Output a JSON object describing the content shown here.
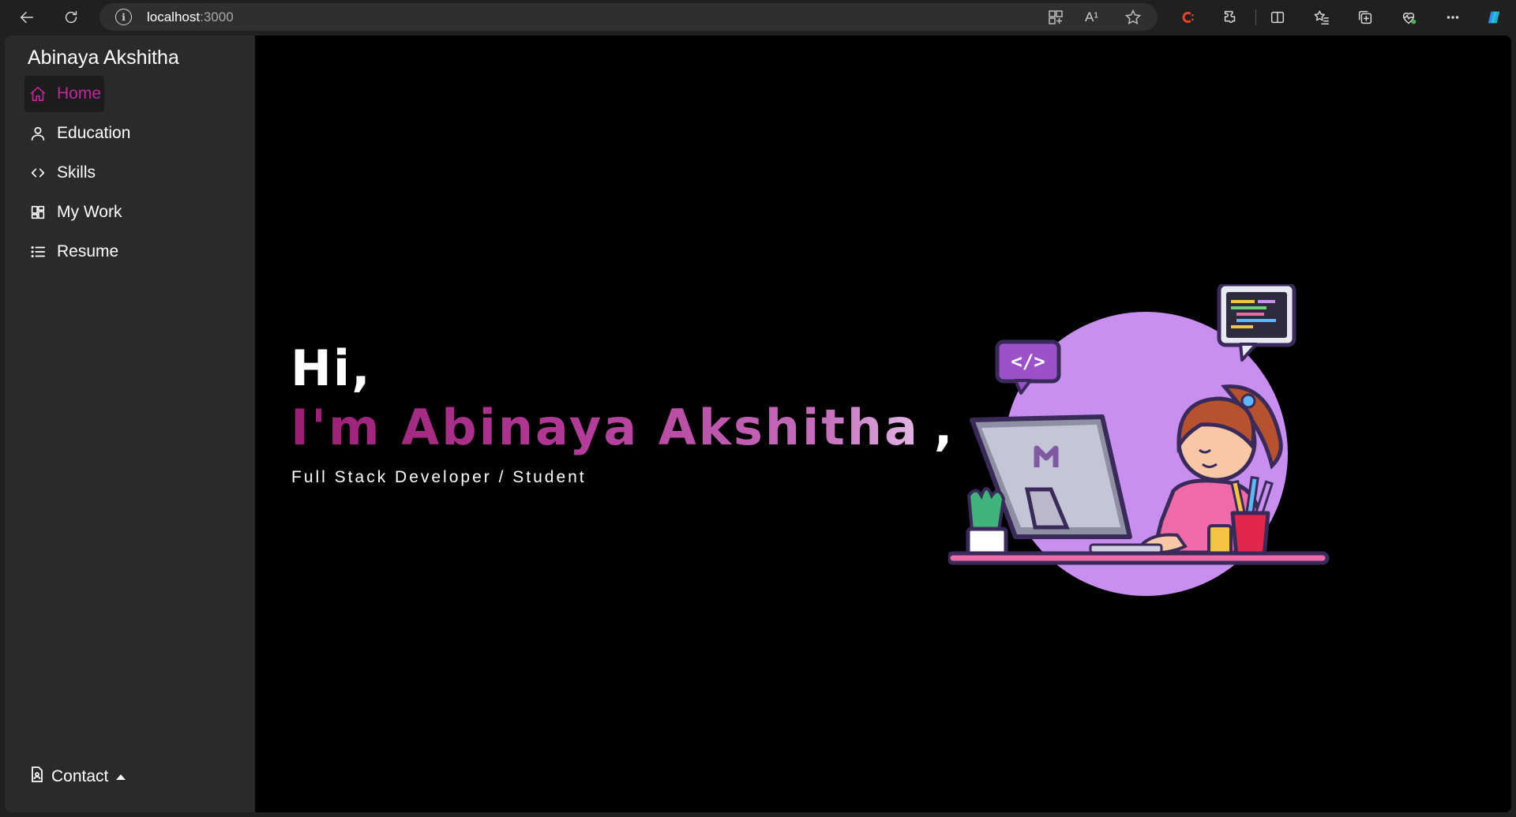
{
  "browser": {
    "url_host": "localhost",
    "url_port": ":3000",
    "read_aloud_label": "A¹",
    "icons": [
      "back-icon",
      "refresh-icon",
      "info-icon",
      "app-grid-icon",
      "read-aloud-icon",
      "favorite-star-icon",
      "extension-c-icon",
      "extensions-icon",
      "split-screen-icon",
      "favorites-icon",
      "collections-icon",
      "browser-essentials-icon",
      "more-icon",
      "copilot-icon"
    ]
  },
  "sidebar": {
    "brand": "Abinaya Akshitha",
    "items": [
      {
        "label": "Home",
        "icon": "home-icon",
        "active": true
      },
      {
        "label": "Education",
        "icon": "person-icon",
        "active": false
      },
      {
        "label": "Skills",
        "icon": "code-icon",
        "active": false
      },
      {
        "label": "My Work",
        "icon": "dashboard-icon",
        "active": false
      },
      {
        "label": "Resume",
        "icon": "list-icon",
        "active": false
      }
    ],
    "contact": {
      "label": "Contact",
      "icon": "contact-doc-icon"
    }
  },
  "hero": {
    "greeting": "Hi,",
    "name_line": "I'm Abinaya Akshitha",
    "comma": ",",
    "subtitle": "Full Stack Developer / Student",
    "illustration_code_label": "</>"
  },
  "colors": {
    "accent": "#c0279a",
    "sidebar_bg": "#2b2a2b",
    "page_bg": "#000000",
    "illustration_circle": "#c88ef0"
  }
}
